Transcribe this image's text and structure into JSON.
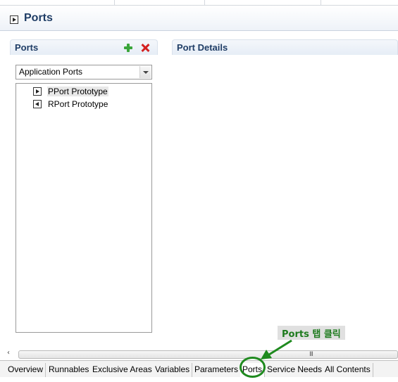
{
  "editor": {
    "title": "Ports"
  },
  "ports_section": {
    "title": "Ports",
    "add_icon": "plus-icon",
    "delete_icon": "delete-x-icon",
    "combo": {
      "value": "Application Ports"
    },
    "tree": [
      {
        "label": "PPort Prototype",
        "icon": "provided-port-icon",
        "selected": true
      },
      {
        "label": "RPort Prototype",
        "icon": "required-port-icon",
        "selected": false
      }
    ]
  },
  "details_section": {
    "title": "Port Details"
  },
  "scrollbar": {
    "left_arrow": "‹",
    "grip": "III"
  },
  "tabs": [
    {
      "label": "Overview"
    },
    {
      "label": "Runnables"
    },
    {
      "label": "Exclusive Areas"
    },
    {
      "label": "Variables"
    },
    {
      "label": "Parameters"
    },
    {
      "label": "Ports",
      "active": true
    },
    {
      "label": "Service Needs"
    },
    {
      "label": "All Contents"
    }
  ],
  "annotation": {
    "text": "Ports 탭 클릭",
    "color": "#1f8a1f"
  }
}
